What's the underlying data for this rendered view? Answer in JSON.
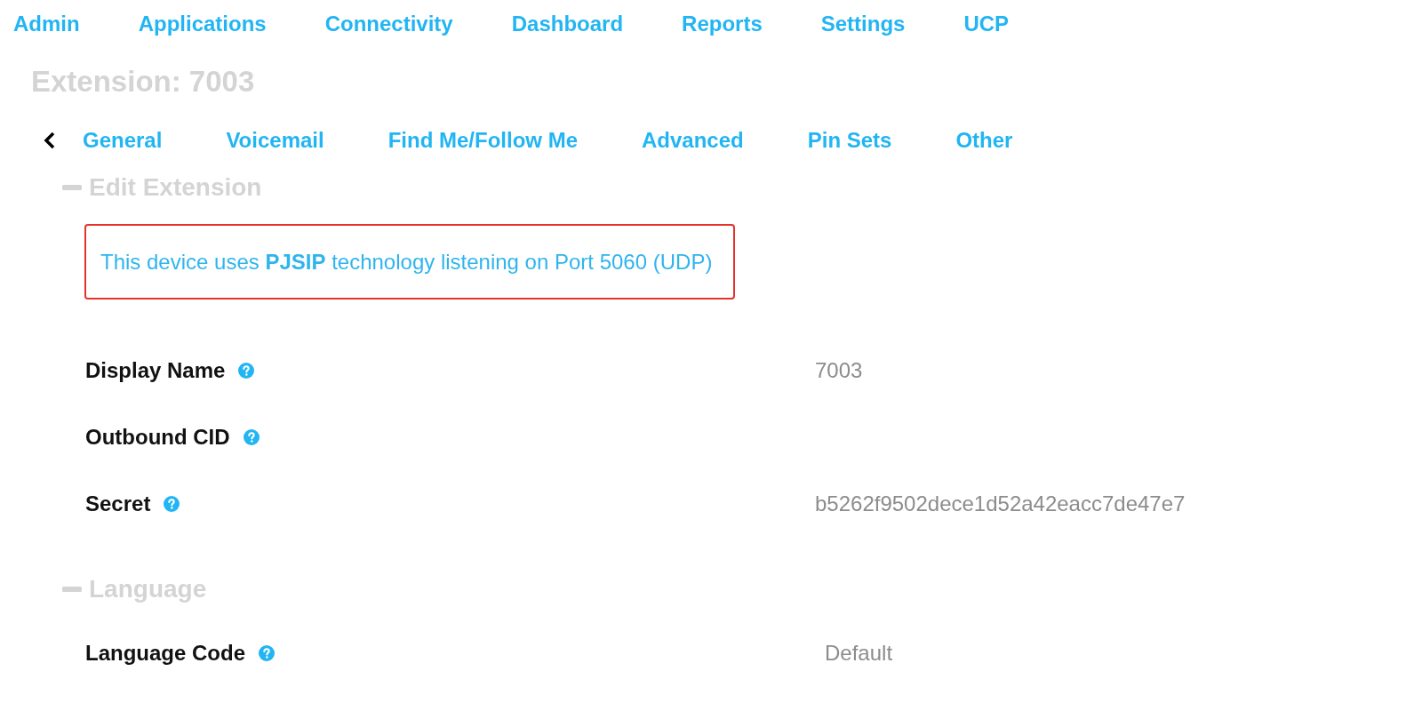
{
  "nav_menu": [
    "Admin",
    "Applications",
    "Connectivity",
    "Dashboard",
    "Reports",
    "Settings",
    "UCP"
  ],
  "page_title": "Extension: 7003",
  "tabs": [
    "General",
    "Voicemail",
    "Find Me/Follow Me",
    "Advanced",
    "Pin Sets",
    "Other"
  ],
  "sections": [
    {
      "title": "Edit Extension",
      "expanded": true,
      "notice": "This device uses **PJSIP** technology listening on Port 5060 (UDP)",
      "fields": [
        {
          "label": "Display Name",
          "value": "7003"
        },
        {
          "label": "Outbound CID"
        },
        {
          "label": "Secret",
          "value": "b5262f9502dece1d52a42eacc7de47e7"
        }
      ]
    },
    {
      "title": "Language",
      "expanded": true,
      "fields": [
        {
          "label": "Language Code",
          "value": "Default"
        }
      ]
    }
  ]
}
